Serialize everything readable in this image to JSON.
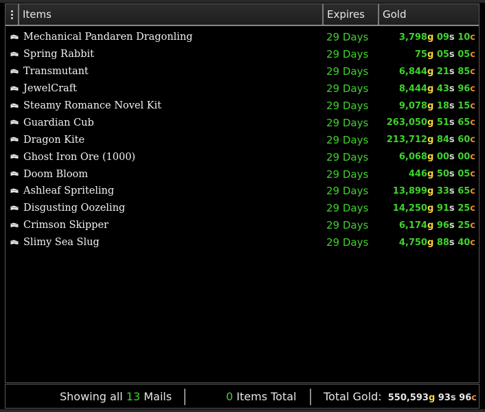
{
  "header": {
    "items": "Items",
    "expires": "Expires",
    "gold": "Gold"
  },
  "rows": [
    {
      "name": "Mechanical Pandaren Dragonling",
      "expires": "29 Days",
      "g": "3,798",
      "s": "09",
      "c": "10"
    },
    {
      "name": "Spring Rabbit",
      "expires": "29 Days",
      "g": "75",
      "s": "05",
      "c": "05"
    },
    {
      "name": "Transmutant",
      "expires": "29 Days",
      "g": "6,844",
      "s": "21",
      "c": "85"
    },
    {
      "name": "JewelCraft",
      "expires": "29 Days",
      "g": "8,444",
      "s": "43",
      "c": "96"
    },
    {
      "name": "Steamy Romance Novel Kit",
      "expires": "29 Days",
      "g": "9,078",
      "s": "18",
      "c": "15"
    },
    {
      "name": "Guardian Cub",
      "expires": "29 Days",
      "g": "263,050",
      "s": "51",
      "c": "65"
    },
    {
      "name": "Dragon Kite",
      "expires": "29 Days",
      "g": "213,712",
      "s": "84",
      "c": "60"
    },
    {
      "name": "Ghost Iron Ore (1000)",
      "expires": "29 Days",
      "g": "6,068",
      "s": "00",
      "c": "00"
    },
    {
      "name": "Doom Bloom",
      "expires": "29 Days",
      "g": "446",
      "s": "50",
      "c": "05"
    },
    {
      "name": "Ashleaf Spriteling",
      "expires": "29 Days",
      "g": "13,899",
      "s": "33",
      "c": "65"
    },
    {
      "name": "Disgusting Oozeling",
      "expires": "29 Days",
      "g": "14,250",
      "s": "91",
      "c": "25"
    },
    {
      "name": "Crimson Skipper",
      "expires": "29 Days",
      "g": "6,174",
      "s": "96",
      "c": "25"
    },
    {
      "name": "Slimy Sea Slug",
      "expires": "29 Days",
      "g": "4,750",
      "s": "88",
      "c": "40"
    }
  ],
  "units": {
    "gold": "g",
    "silver": "s",
    "copper": "c"
  },
  "footer": {
    "showing_prefix": "Showing all",
    "mail_count": "13",
    "showing_suffix": "Mails",
    "items_count": "0",
    "items_label": "Items Total",
    "total_label": "Total Gold:",
    "total_g": "550,593",
    "total_s": "93",
    "total_c": "96"
  },
  "icons": {
    "row_icon": "envelope-icon",
    "menu_icon": "vertical-dots-icon"
  },
  "colors": {
    "expires": "#3fd22c",
    "gold_unit": "#f5d73b",
    "silver_unit": "#d7d7d7",
    "copper_unit": "#e38b3a"
  }
}
